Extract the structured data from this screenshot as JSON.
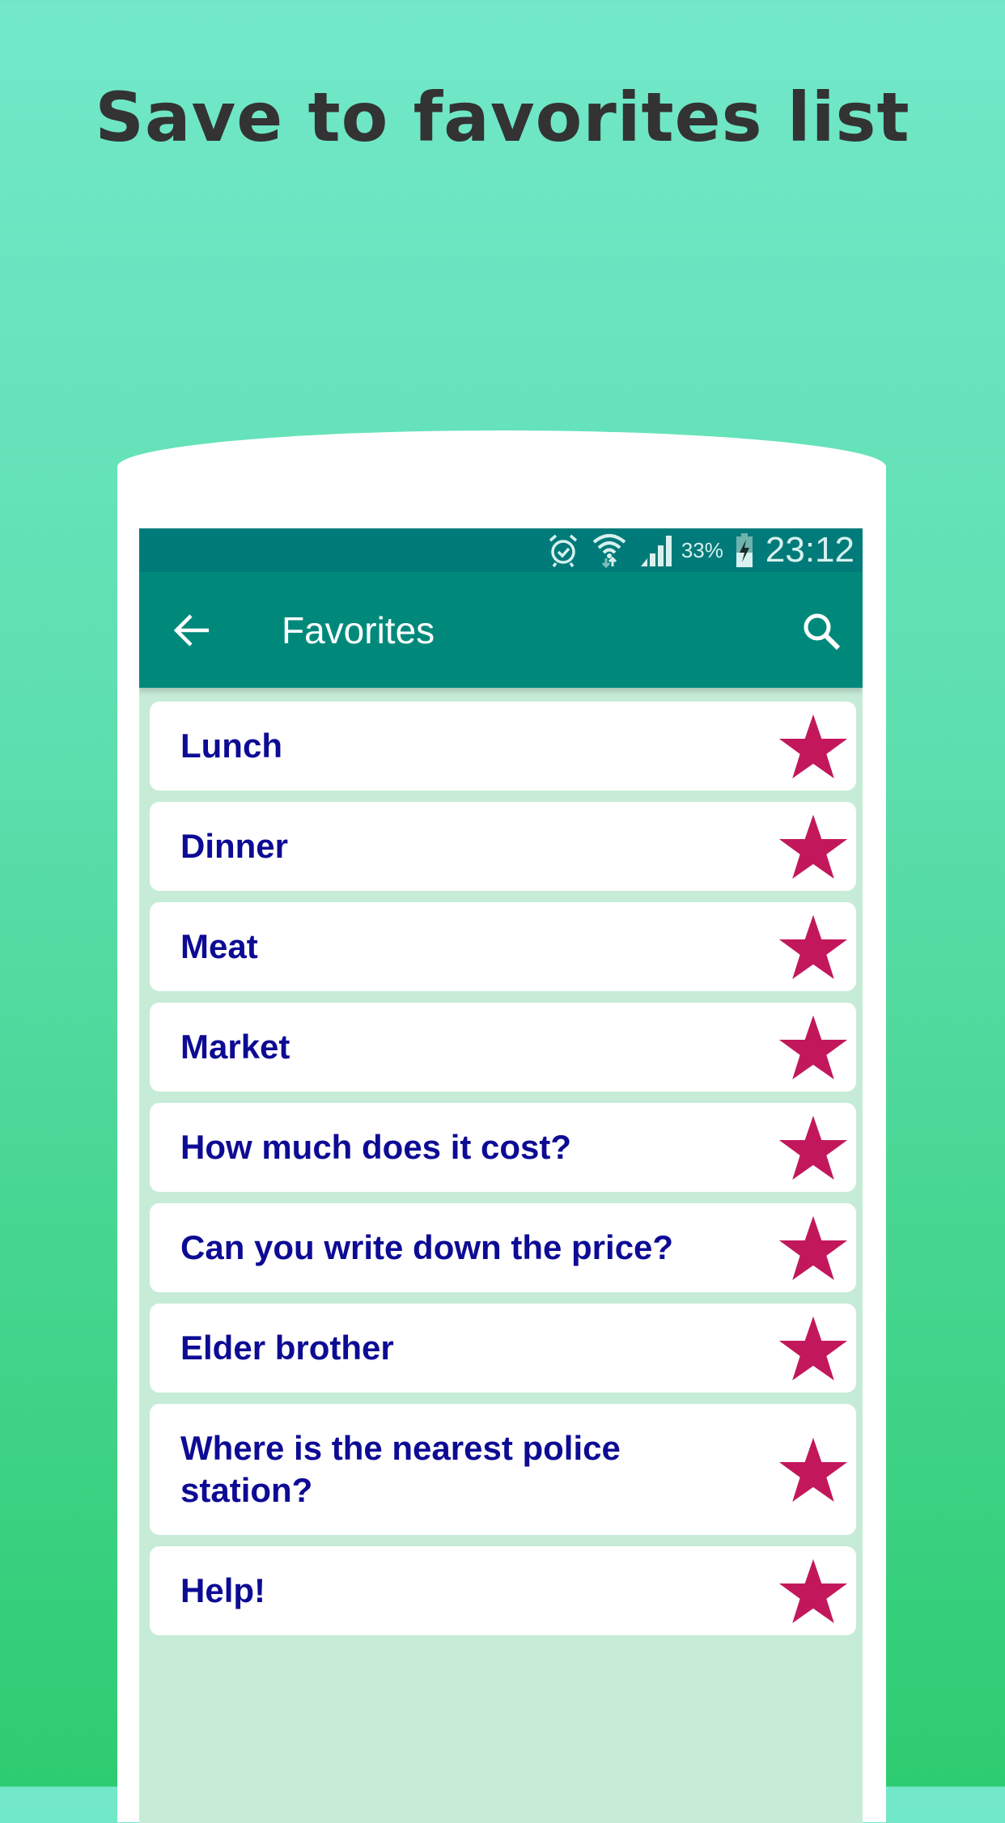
{
  "promo": {
    "headline": "Save to favorites list"
  },
  "status_bar": {
    "icons": [
      "alarm-icon",
      "wifi-icon",
      "signal-icon",
      "battery-charging-icon"
    ],
    "battery_percent": "33%",
    "time": "23:12"
  },
  "app_bar": {
    "back_icon": "arrow-left-icon",
    "title": "Favorites",
    "search_icon": "search-icon"
  },
  "favorites": [
    {
      "text": "Lunch",
      "starred": true
    },
    {
      "text": "Dinner",
      "starred": true
    },
    {
      "text": "Meat",
      "starred": true
    },
    {
      "text": "Market",
      "starred": true
    },
    {
      "text": "How much does it cost?",
      "starred": true
    },
    {
      "text": "Can you write down the price?",
      "starred": true
    },
    {
      "text": "Elder brother",
      "starred": true
    },
    {
      "text": "Where is the nearest police station?",
      "starred": true
    },
    {
      "text": "Help!",
      "starred": true
    }
  ],
  "colors": {
    "status_bar": "#007B7A",
    "app_bar": "#00897B",
    "list_background": "#C6EBD7",
    "item_text": "#0D0B94",
    "star": "#C2185B",
    "headline": "#333333"
  }
}
